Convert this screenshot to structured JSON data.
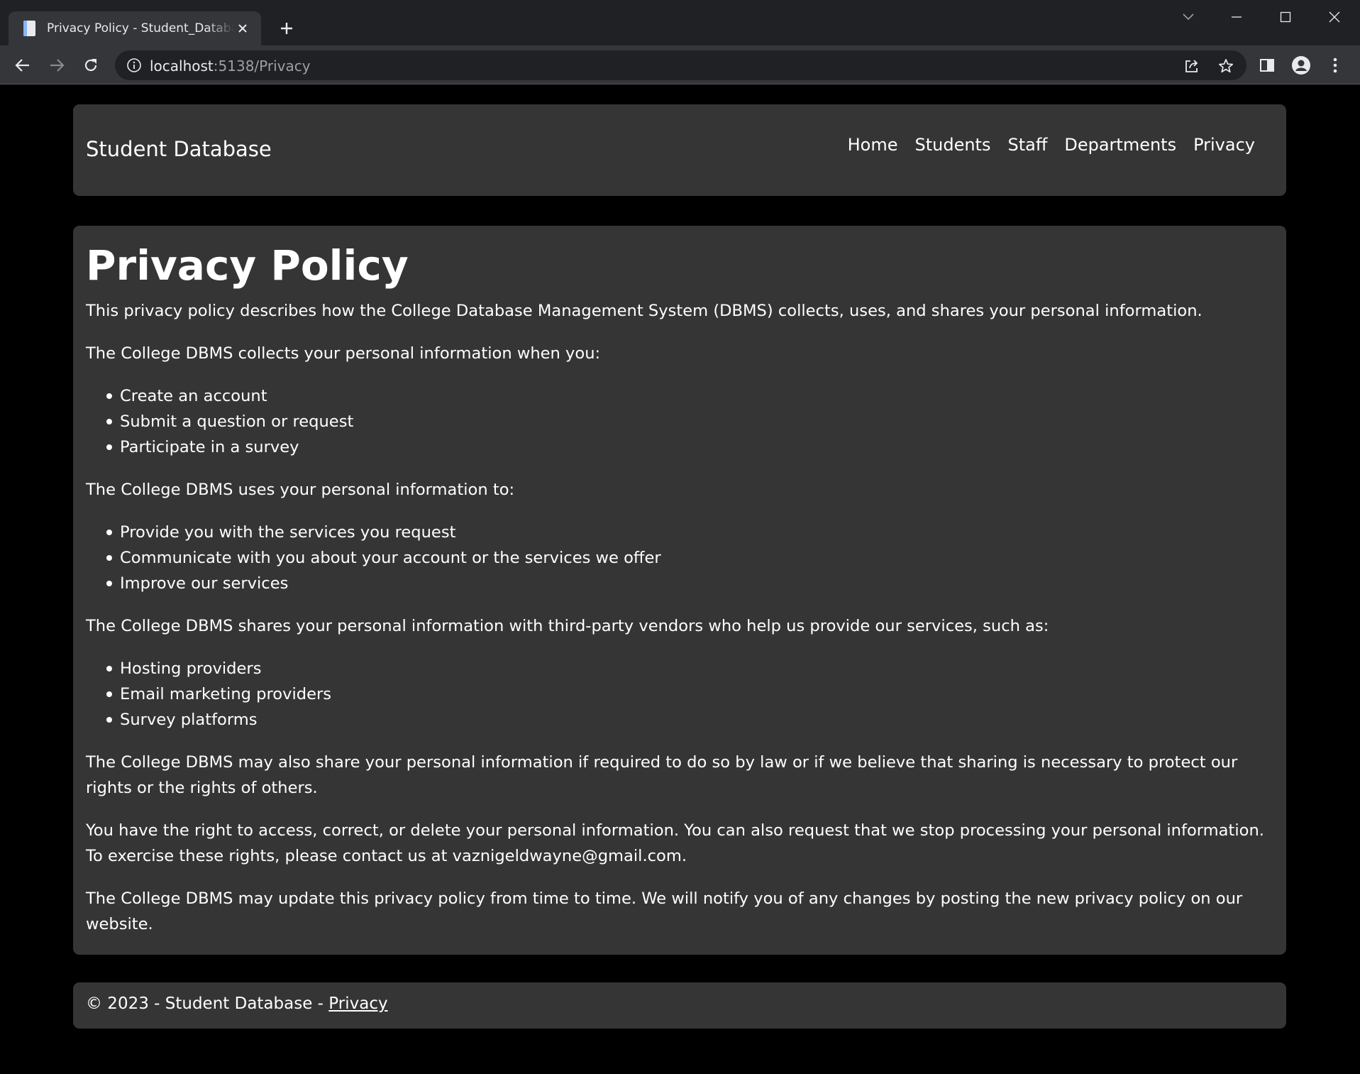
{
  "browser": {
    "tab_title": "Privacy Policy - Student_Database",
    "url_host": "localhost",
    "url_rest": ":5138/Privacy"
  },
  "site": {
    "brand": "Student Database",
    "nav": [
      "Home",
      "Students",
      "Staff",
      "Departments",
      "Privacy"
    ]
  },
  "policy": {
    "heading": "Privacy Policy",
    "intro": "This privacy policy describes how the College Database Management System (DBMS) collects, uses, and shares your personal information.",
    "collects_intro": "The College DBMS collects your personal information when you:",
    "collects": [
      "Create an account",
      "Submit a question or request",
      "Participate in a survey"
    ],
    "uses_intro": "The College DBMS uses your personal information to:",
    "uses": [
      "Provide you with the services you request",
      "Communicate with you about your account or the services we offer",
      "Improve our services"
    ],
    "shares_intro": "The College DBMS shares your personal information with third-party vendors who help us provide our services, such as:",
    "shares": [
      "Hosting providers",
      "Email marketing providers",
      "Survey platforms"
    ],
    "law": "The College DBMS may also share your personal information if required to do so by law or if we believe that sharing is necessary to protect our rights or the rights of others.",
    "rights": "You have the right to access, correct, or delete your personal information. You can also request that we stop processing your personal information. To exercise these rights, please contact us at vaznigeldwayne@gmail.com.",
    "updates": "The College DBMS may update this privacy policy from time to time. We will notify you of any changes by posting the new privacy policy on our website."
  },
  "footer": {
    "text": "© 2023 - Student Database - ",
    "link": "Privacy"
  }
}
